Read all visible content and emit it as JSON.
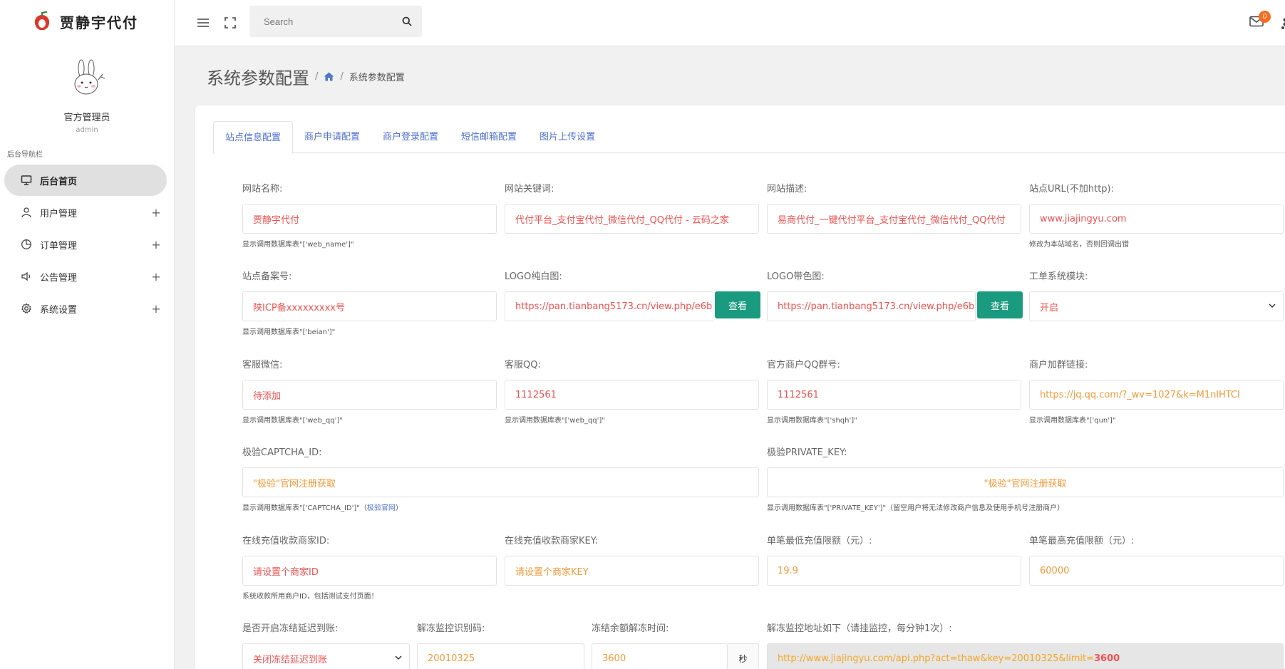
{
  "brand": {
    "name": "贾静宇代付"
  },
  "profile": {
    "name": "官方管理员",
    "role": "admin"
  },
  "nav": {
    "caption": "后台导航栏",
    "items": [
      {
        "label": "后台首页",
        "icon": "monitor-icon",
        "active": true
      },
      {
        "label": "用户管理",
        "icon": "user-icon",
        "plus": "+"
      },
      {
        "label": "订单管理",
        "icon": "clock-pie-icon",
        "plus": "+"
      },
      {
        "label": "公告管理",
        "icon": "speaker-icon",
        "plus": "+"
      },
      {
        "label": "系统设置",
        "icon": "gear-icon",
        "plus": "+"
      }
    ]
  },
  "topbar": {
    "search_placeholder": "Search",
    "mail_count": "0"
  },
  "page": {
    "title": "系统参数配置",
    "breadcrumb_current": "系统参数配置",
    "breadcrumb_sep": "/"
  },
  "tabs": [
    "站点信息配置",
    "商户申请配置",
    "商户登录配置",
    "短信邮箱配置",
    "图片上传设置"
  ],
  "form": {
    "web_name": {
      "label": "网站名称:",
      "value": "贾静宇代付",
      "hint": "显示调用数据库表\"['web_name']\""
    },
    "keywords": {
      "label": "网站关键词:",
      "value": "代付平台_支付宝代付_微信代付_QQ代付 - 云码之家"
    },
    "description": {
      "label": "网站描述:",
      "value": "易商代付_一键代付平台_支付宝代付_微信代付_QQ代付"
    },
    "site_url": {
      "label": "站点URL(不加http):",
      "value": "www.jiajingyu.com",
      "hint": "修改为本站域名，否则回调出错"
    },
    "beian": {
      "label": "站点备案号:",
      "value": "陕ICP备xxxxxxxxx号",
      "hint": "显示调用数据库表\"['beian']\""
    },
    "logo_white": {
      "label": "LOGO纯白图:",
      "value": "https://pan.tianbang5173.cn/view.php/e6b",
      "button": "查看"
    },
    "logo_color": {
      "label": "LOGO带色图:",
      "value": "https://pan.tianbang5173.cn/view.php/e6b",
      "button": "查看"
    },
    "ticket": {
      "label": "工单系统模块:",
      "value": "开启"
    },
    "wechat": {
      "label": "客服微信:",
      "value": "待添加",
      "hint": "显示调用数据库表\"['web_qq']\""
    },
    "qq": {
      "label": "客服QQ:",
      "value": "1112561",
      "hint": "显示调用数据库表\"['web_qq']\""
    },
    "qq_group": {
      "label": "官方商户QQ群号:",
      "value": "1112561",
      "hint": "显示调用数据库表\"['shqh']\""
    },
    "group_link": {
      "label": "商户加群链接:",
      "value": "https://jq.qq.com/?_wv=1027&k=M1nlHTCI",
      "hint": "显示调用数据库表\"['qun']\""
    },
    "captcha_id": {
      "label": "极验CAPTCHA_ID:",
      "value": "\"极验\"官网注册获取",
      "hint": "显示调用数据库表\"['CAPTCHA_ID']\"（",
      "hint_link": "极验官网",
      "hint_end": "）"
    },
    "private_key": {
      "label": "极验PRIVATE_KEY:",
      "value": "\"极验\"官网注册获取",
      "hint": "显示调用数据库表\"['PRIVATE_KEY']\"（留空用户将无法修改商户信息及使用手机号注册商户）"
    },
    "merchant_id": {
      "label": "在线充值收款商家ID:",
      "value": "请设置个商家ID",
      "hint": "系统收款所用商户ID，包括测试支付页面！"
    },
    "merchant_key": {
      "label": "在线充值收款商家KEY:",
      "value": "请设置个商家KEY"
    },
    "min_recharge": {
      "label": "单笔最低充值限额（元）:",
      "value": "19.9"
    },
    "max_recharge": {
      "label": "单笔最高充值限额（元）:",
      "value": "60000"
    },
    "freeze": {
      "label": "是否开启冻结延迟到账:",
      "value": "关闭冻结延迟到账"
    },
    "monitor_code": {
      "label": "解冻监控识别码:",
      "value": "20010325"
    },
    "unfreeze_time": {
      "label": "冻结余额解冻时间:",
      "value": "3600",
      "unit": "秒"
    },
    "monitor_url": {
      "label": "解冻监控地址如下（请挂监控，每分钟1次）:",
      "value_prefix": "http://www.jiajingyu.com/api.php?act=thaw&key=20010325&limit=",
      "value_bold": "3600"
    }
  },
  "colors": {
    "accent": "#4f6fd0",
    "button": "#1a9a7e",
    "value_red": "#f25050",
    "value_orange": "#f59a3a",
    "badge": "#fa6b1e"
  }
}
